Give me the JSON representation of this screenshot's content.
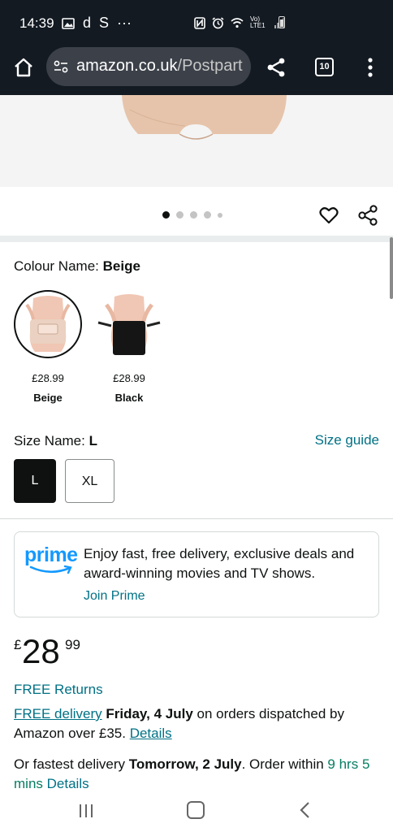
{
  "status_bar": {
    "time": "14:39",
    "left_glyphs": [
      "d",
      "S",
      "···"
    ],
    "network_label": "Vo) LTE1"
  },
  "browser": {
    "url_domain": "amazon.co.uk",
    "url_path": "/Postpart",
    "tab_count": "10"
  },
  "carousel": {
    "dot_count": 5,
    "active_index": 0
  },
  "colour": {
    "label": "Colour Name:",
    "selected_value": "Beige",
    "options": [
      {
        "price": "£28.99",
        "name": "Beige",
        "selected": true
      },
      {
        "price": "£28.99",
        "name": "Black",
        "selected": false
      }
    ]
  },
  "size": {
    "label": "Size Name:",
    "selected_value": "L",
    "guide_link": "Size guide",
    "options": [
      "L",
      "XL"
    ]
  },
  "prime": {
    "logo_text": "prime",
    "message": "Enjoy fast, free delivery, exclusive deals and award-winning movies and TV shows.",
    "cta": "Join Prime"
  },
  "price": {
    "currency": "£",
    "whole": "28",
    "fraction": "99"
  },
  "shipping": {
    "free_returns": "FREE Returns",
    "free_delivery_link": "FREE delivery",
    "delivery_date": "Friday, 4 July",
    "delivery_condition": "on orders dispatched by Amazon over £35.",
    "details_link": "Details",
    "fastest_prefix": "Or fastest delivery",
    "fastest_date": "Tomorrow, 2 July",
    "order_within": ". Order within",
    "countdown": "9 hrs 5 mins",
    "fastest_details": "Details"
  },
  "colors": {
    "header_bg": "#131a22",
    "link": "#007185",
    "prime_blue": "#1399ff",
    "accent_text": "#0f1111"
  }
}
